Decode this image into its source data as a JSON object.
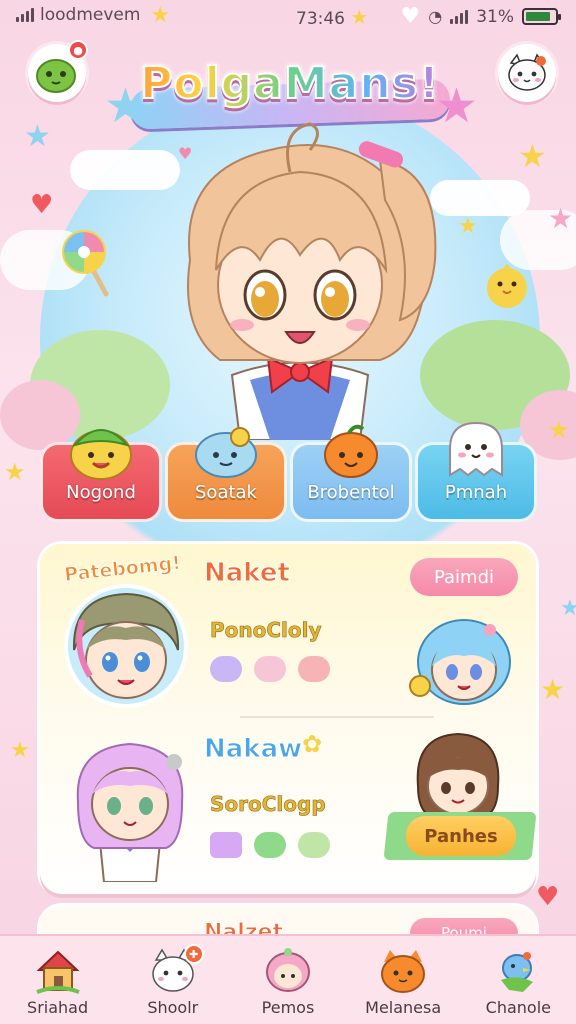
{
  "status_bar": {
    "carrier": "loodmevem",
    "time": "73:46",
    "battery_percent": "31%",
    "battery_level": 0.85
  },
  "title": "PolgaMans!",
  "categories": [
    {
      "label": "Nogond",
      "color": "#f0595f",
      "icon": "leaf-creature-icon"
    },
    {
      "label": "Soatak",
      "color": "#f69447",
      "icon": "blue-pet-icon"
    },
    {
      "label": "Brobentol",
      "color": "#7cc0f0",
      "icon": "orange-fruit-icon"
    },
    {
      "label": "Pmnah",
      "color": "#55c3ea",
      "icon": "ghost-icon"
    }
  ],
  "card": {
    "rows": [
      {
        "badge": "Patebomg!",
        "name": "Naket",
        "subtitle": "PonoCloly",
        "button": "Paimdi"
      },
      {
        "name": "Nakaw",
        "subtitle": "SoroClogp",
        "button": "Panhes"
      }
    ],
    "next_name": "Nalzet",
    "next_button": "Poumi"
  },
  "bottom_nav": [
    {
      "label": "Sriahad",
      "icon": "house-icon"
    },
    {
      "label": "Shoolr",
      "icon": "cat-face-icon",
      "has_badge": true
    },
    {
      "label": "Pemos",
      "icon": "pink-character-icon"
    },
    {
      "label": "Melanesa",
      "icon": "orange-cat-icon"
    },
    {
      "label": "Chanole",
      "icon": "bird-icon"
    }
  ]
}
